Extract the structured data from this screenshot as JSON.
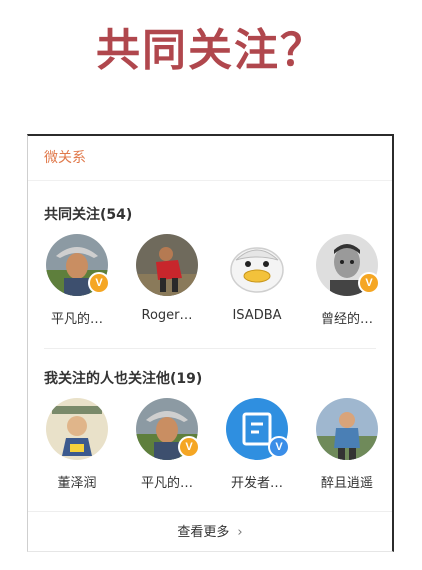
{
  "headline": "共同关注？",
  "card": {
    "header": "微关系",
    "common": {
      "title": "共同关注(54)",
      "users": [
        {
          "name": "平凡的…",
          "verified": "gold"
        },
        {
          "name": "Roger…",
          "verified": ""
        },
        {
          "name": "ISADBA",
          "verified": ""
        },
        {
          "name": "曾经的…",
          "verified": "gold"
        }
      ]
    },
    "mutual": {
      "title": "我关注的人也关注他(19)",
      "users": [
        {
          "name": "董泽润",
          "verified": ""
        },
        {
          "name": "平凡的…",
          "verified": "gold"
        },
        {
          "name": "开发者…",
          "verified": "blue"
        },
        {
          "name": "醉且逍遥",
          "verified": ""
        }
      ]
    },
    "footer": {
      "label": "查看更多",
      "icon": "chevron-right-icon"
    }
  },
  "colors": {
    "headline": "#b0474d",
    "header": "#e0794b",
    "gold_badge": "#f5a623",
    "blue_badge": "#3b8ee8"
  }
}
